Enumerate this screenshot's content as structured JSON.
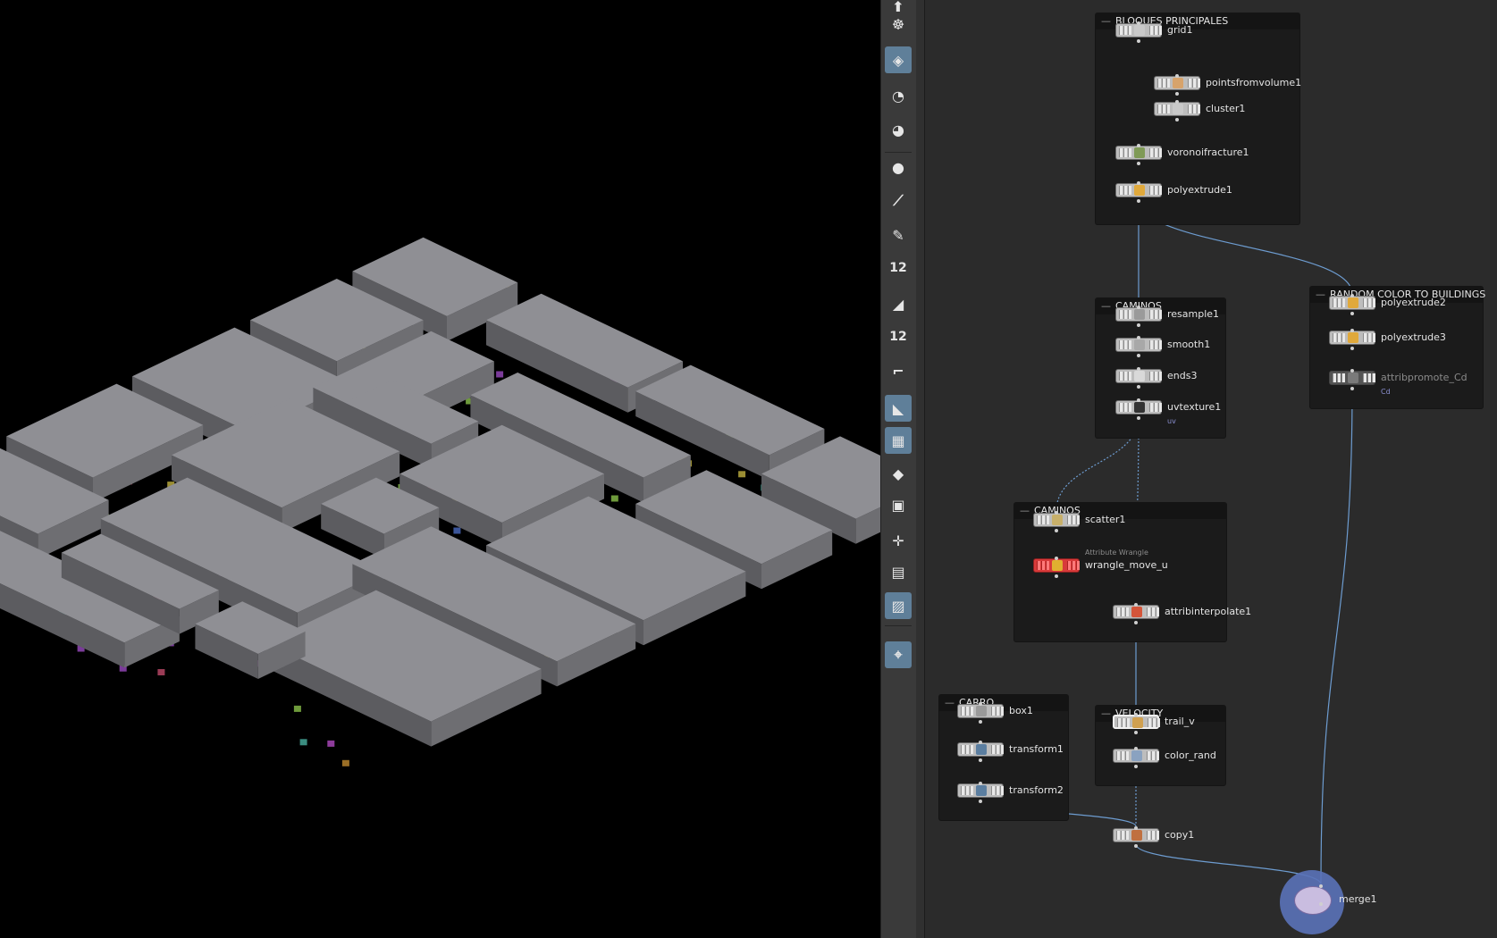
{
  "viewport": {
    "background": "#000000",
    "building_color": "#8f8f94"
  },
  "toolbar": {
    "tools": [
      {
        "name": "handle-tool-icon",
        "glyph": "⬆",
        "active": false
      },
      {
        "name": "pose-tool-icon",
        "glyph": "☸",
        "active": false
      },
      {
        "name": "texture-view-icon",
        "glyph": "◈",
        "active": true
      },
      {
        "name": "camera-eye-icon",
        "glyph": "◔",
        "active": false
      },
      {
        "name": "render-view-icon",
        "glyph": "◕",
        "active": false
      },
      {
        "name": "point-icon",
        "glyph": "●",
        "active": false
      },
      {
        "name": "paint-brush-icon",
        "glyph": "⟋",
        "active": false
      },
      {
        "name": "pen-tool-icon",
        "glyph": "✎",
        "active": false
      },
      {
        "name": "point-numbers-icon",
        "glyph": "12",
        "active": false
      },
      {
        "name": "edge-tool-icon",
        "glyph": "◢",
        "active": false
      },
      {
        "name": "prim-numbers-icon",
        "glyph": "12",
        "active": false
      },
      {
        "name": "curve-tool-icon",
        "glyph": "⌐",
        "active": false
      },
      {
        "name": "shaded-view-icon",
        "glyph": "◣",
        "active": true
      },
      {
        "name": "checker-view-icon",
        "glyph": "▦",
        "active": true
      },
      {
        "name": "ghost-view-icon",
        "glyph": "◆",
        "active": false
      },
      {
        "name": "uv-grid-icon",
        "glyph": "▣",
        "active": false
      },
      {
        "name": "snap-tool-icon",
        "glyph": "✛",
        "active": false
      },
      {
        "name": "safe-area-icon",
        "glyph": "▤",
        "active": false
      },
      {
        "name": "background-image-icon",
        "glyph": "▨",
        "active": true
      },
      {
        "name": "location-pin-icon",
        "glyph": "⌖",
        "active": true
      }
    ]
  },
  "network": {
    "boxes": [
      {
        "id": "bloques",
        "title": "BLOQUES PRINCIPALES"
      },
      {
        "id": "caminos1",
        "title": "CAMINOS"
      },
      {
        "id": "random",
        "title": "RANDOM COLOR TO BUILDINGS"
      },
      {
        "id": "caminos2",
        "title": "CAMINOS"
      },
      {
        "id": "carro",
        "title": "CARRO"
      },
      {
        "id": "velocity",
        "title": "VELOCITY"
      }
    ],
    "nodes": [
      {
        "id": "grid1",
        "label": "grid1",
        "icon": "#c9c9c9"
      },
      {
        "id": "pfv",
        "label": "pointsfromvolume1",
        "icon": "#d7a36b"
      },
      {
        "id": "cluster1",
        "label": "cluster1",
        "icon": "#c9c9c9"
      },
      {
        "id": "voronoi",
        "label": "voronoifracture1",
        "icon": "#7f9a56"
      },
      {
        "id": "polyext1",
        "label": "polyextrude1",
        "icon": "#e0a93c"
      },
      {
        "id": "resample1",
        "label": "resample1",
        "icon": "#9a9a9a"
      },
      {
        "id": "smooth1",
        "label": "smooth1",
        "icon": "#a8a8a8"
      },
      {
        "id": "ends3",
        "label": "ends3",
        "icon": "#d9d9d9"
      },
      {
        "id": "uvtex1",
        "label": "uvtexture1",
        "icon": "#333333",
        "flag": "uv"
      },
      {
        "id": "polyext2",
        "label": "polyextrude2",
        "icon": "#e0a93c"
      },
      {
        "id": "polyext3",
        "label": "polyextrude3",
        "icon": "#e0a93c"
      },
      {
        "id": "attrpromote",
        "label": "attribpromote_Cd",
        "icon": "#7a7a7a",
        "flag": "Cd"
      },
      {
        "id": "scatter1",
        "label": "scatter1",
        "icon": "#c8b06a"
      },
      {
        "id": "wrangle",
        "label": "wrangle_move_u",
        "sub": "Attribute Wrangle",
        "icon": "#e0b030"
      },
      {
        "id": "attrinterp",
        "label": "attribinterpolate1",
        "icon": "#d4553a"
      },
      {
        "id": "box1",
        "label": "box1",
        "icon": "#9a9a9a"
      },
      {
        "id": "transform1",
        "label": "transform1",
        "icon": "#5b7ea0"
      },
      {
        "id": "transform2",
        "label": "transform2",
        "icon": "#5b7ea0"
      },
      {
        "id": "trail",
        "label": "trail_v",
        "icon": "#d0a050"
      },
      {
        "id": "colorrand",
        "label": "color_rand",
        "icon": "#8aa2c0"
      },
      {
        "id": "copy1",
        "label": "copy1",
        "icon": "#c07040"
      },
      {
        "id": "merge1",
        "label": "merge1",
        "icon": "#7a5aa0"
      }
    ]
  }
}
